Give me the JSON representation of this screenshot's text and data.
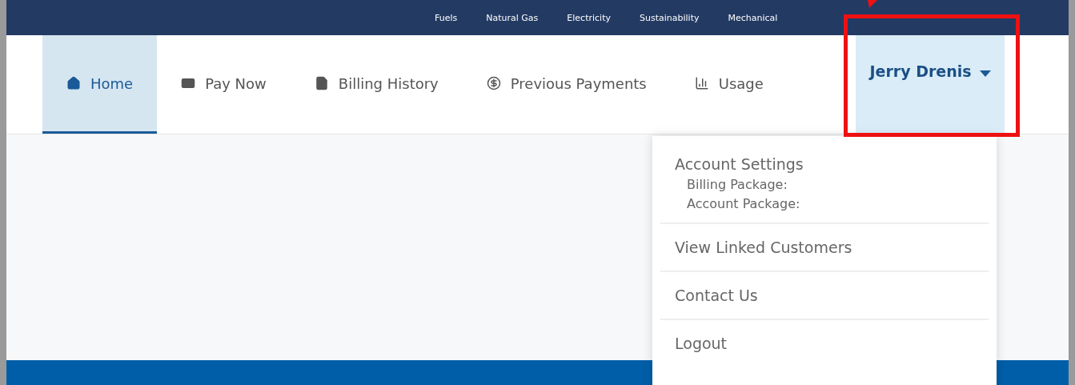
{
  "top_links": [
    "Fuels",
    "Natural Gas",
    "Electricity",
    "Sustainability",
    "Mechanical"
  ],
  "nav": [
    {
      "label": "Home",
      "selected": true
    },
    {
      "label": "Pay Now",
      "selected": false
    },
    {
      "label": "Billing History",
      "selected": false
    },
    {
      "label": "Previous Payments",
      "selected": false
    },
    {
      "label": "Usage",
      "selected": false
    }
  ],
  "user_menu": {
    "name": "Jerry Drenis",
    "expanded": true,
    "items": [
      {
        "kind": "group",
        "label": "Account Settings",
        "details": [
          "Billing Package:",
          "Account Package:"
        ]
      },
      {
        "kind": "link",
        "label": "View Linked Customers"
      },
      {
        "kind": "link",
        "label": "Contact Us"
      },
      {
        "kind": "link",
        "label": "Logout"
      }
    ]
  }
}
